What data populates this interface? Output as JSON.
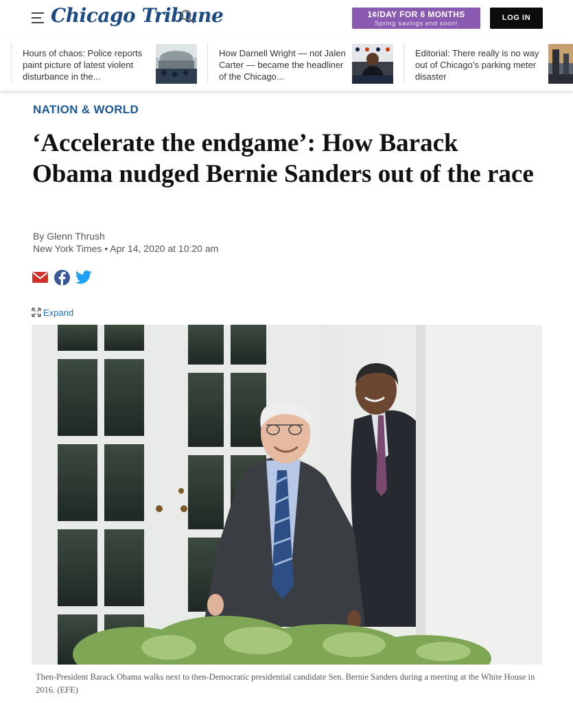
{
  "header": {
    "logo_text": "Chicago Tribune",
    "promo_line1": "1¢/DAY FOR 6 MONTHS",
    "promo_line2": "Spring savings end soon!",
    "login_label": "LOG IN",
    "icons": [
      "menu-icon",
      "search-icon"
    ]
  },
  "trending": [
    {
      "text": "Hours of chaos: Police reports paint picture of latest violent disturbance in the..."
    },
    {
      "text": "How Darnell Wright — not Jalen Carter — became the headliner of the Chicago..."
    },
    {
      "text": "Editorial: There really is no way out of Chicago’s parking meter disaster"
    }
  ],
  "article": {
    "section": "NATION & WORLD",
    "headline": "‘Accelerate the endgame’: How Barack Obama nudged Bernie Sanders out of the race",
    "byline_prefix": "By ",
    "author": "Glenn Thrush",
    "meta": "New York Times • Apr 14, 2020 at 10:20 am",
    "share_icons": [
      "email-icon",
      "facebook-icon",
      "twitter-icon"
    ],
    "expand_label": "Expand",
    "caption": "Then-President Barack Obama walks next to then-Democratic presidential candidate Sen. Bernie Sanders during a meeting at the White House in 2016. (EFE)"
  },
  "colors": {
    "brand_blue": "#1b4a84",
    "section_blue": "#1b5797",
    "promo_purple": "#8a5ab0",
    "login_black": "#0c0c0c",
    "email_red": "#d1312b",
    "facebook_blue": "#3b5998",
    "twitter_blue": "#1da1f2",
    "link_blue": "#1b6fbf"
  }
}
